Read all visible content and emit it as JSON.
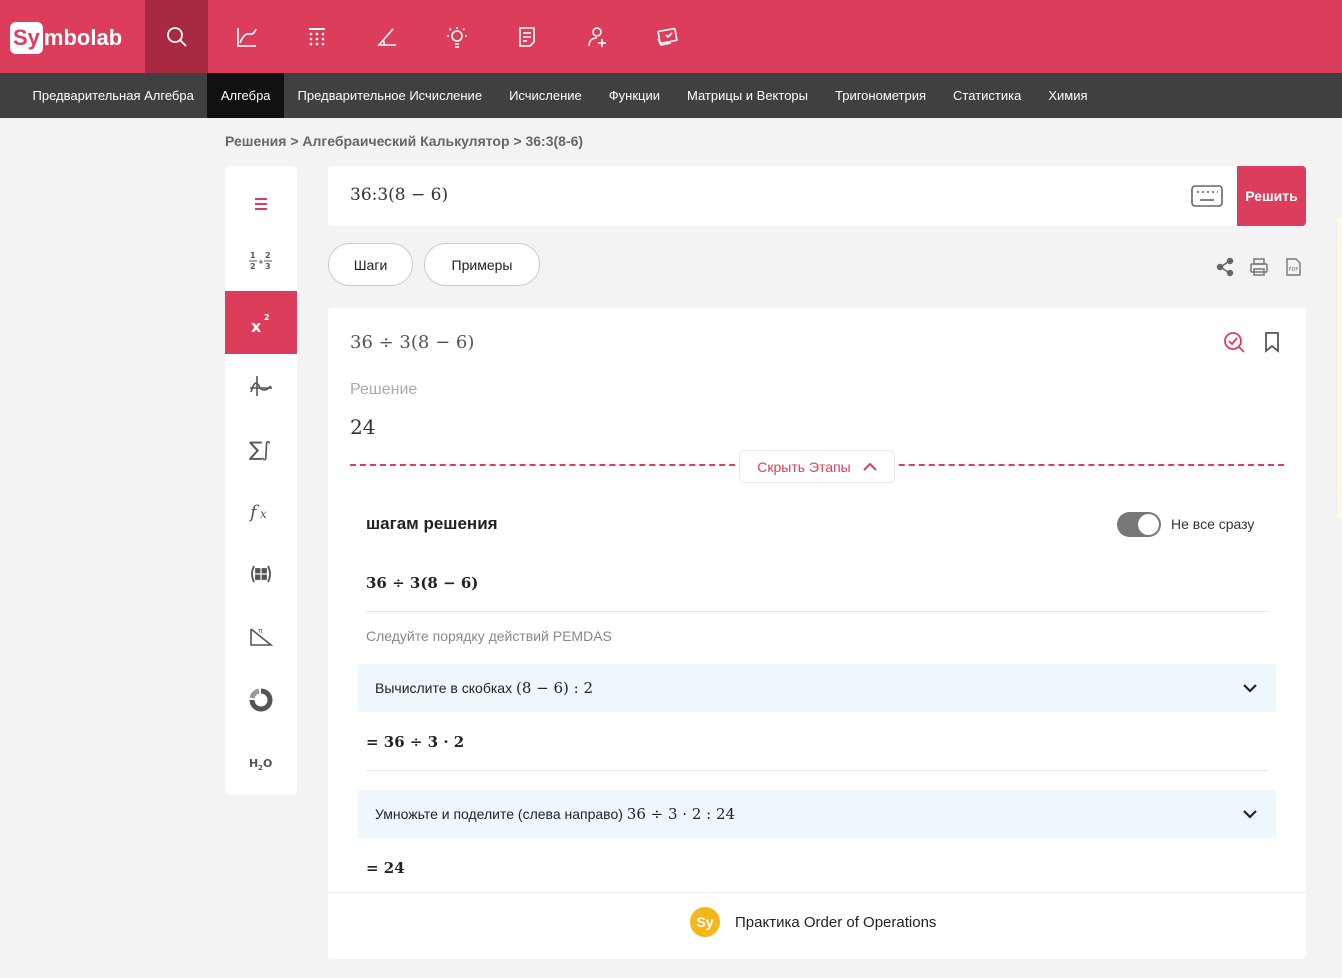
{
  "app": {
    "logo_sy": "Sy",
    "logo_rest": "mbolab",
    "brand_color": "#dc3d5b"
  },
  "top_icons": [
    {
      "name": "search-icon",
      "active": true
    },
    {
      "name": "graph-icon"
    },
    {
      "name": "calculator-icon"
    },
    {
      "name": "geometry-icon"
    },
    {
      "name": "bulb-icon"
    },
    {
      "name": "notebook-icon"
    },
    {
      "name": "add-user-icon"
    },
    {
      "name": "practice-icon"
    }
  ],
  "subnav": [
    {
      "label": "Предварительная Алгебра"
    },
    {
      "label": "Алгебра",
      "active": true
    },
    {
      "label": "Предварительное Исчисление"
    },
    {
      "label": "Исчисление"
    },
    {
      "label": "Функции"
    },
    {
      "label": "Матрицы и Векторы"
    },
    {
      "label": "Тригонометрия"
    },
    {
      "label": "Статистика"
    },
    {
      "label": "Химия"
    }
  ],
  "breadcrumb": "Решения > Алгебраический Калькулятор > 36:3(8-6)",
  "input": {
    "value": "36:3(8 − 6)",
    "solve_label": "Решить"
  },
  "pills": {
    "steps": "Шаги",
    "examples": "Примеры"
  },
  "card": {
    "problem": "36 ÷ 3(8 − 6)",
    "solution_label": "Решение",
    "solution_value": "24",
    "hide_steps": "Скрыть Этапы",
    "steps_title": "шагам решения",
    "toggle_label": "Не все сразу",
    "step_start": "36 ÷ 3(8 − 6)",
    "pemdas": "Следуйте порядку действий PEMDAS",
    "step1": {
      "text": "Вычислите в скобках",
      "math": "(8 − 6) :   2"
    },
    "result1": "= 36 ÷ 3 · 2",
    "step2": {
      "text": "Умножьте и поделите (слева направо)",
      "math": "36 ÷ 3 · 2 :   24"
    },
    "result2": "= 24"
  },
  "practice": {
    "logo": "Sy",
    "text": "Практика Order of Operations"
  }
}
